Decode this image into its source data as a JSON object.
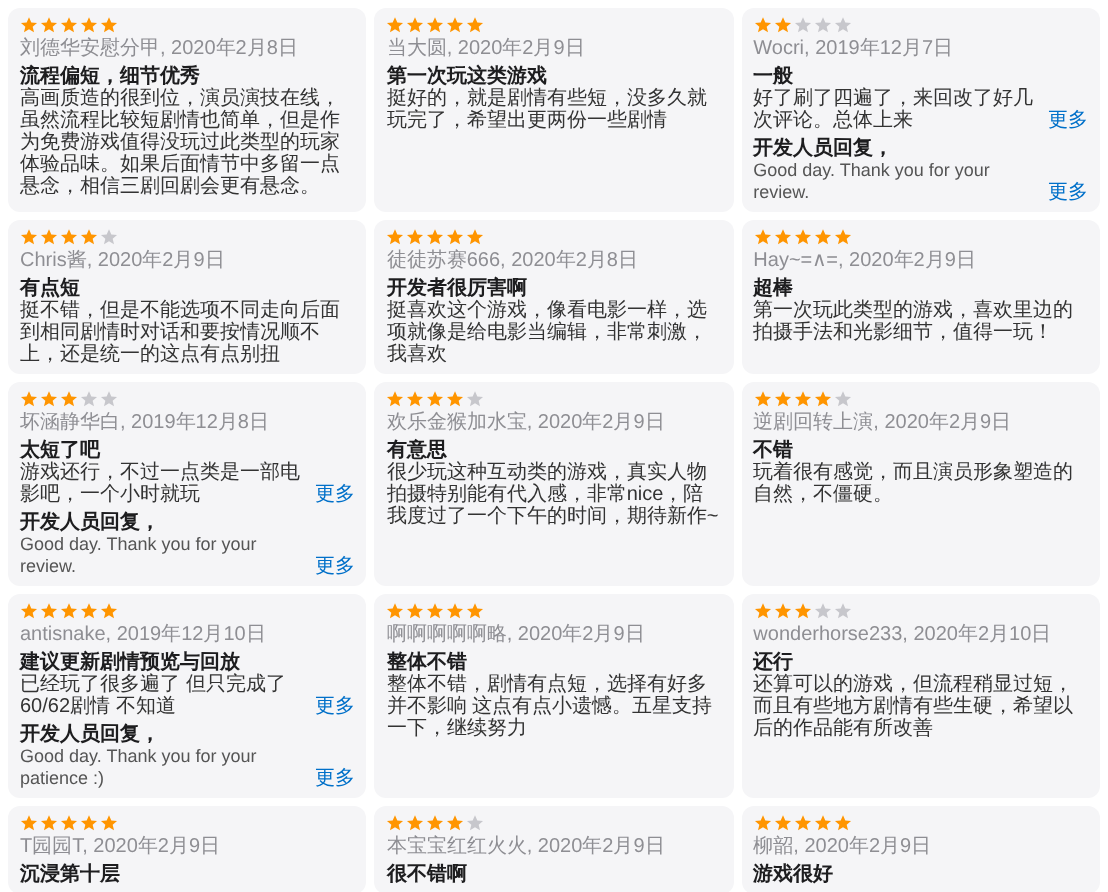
{
  "reviews": [
    {
      "stars": 5,
      "byline": "刘德华安慰分甲, 2020年2月8日",
      "title": "流程偏短，细节优秀",
      "body": "高画质造的很到位，演员演技在线，虽然流程比较短剧情也简单，但是作为免费游戏值得没玩过此类型的玩家体验品味。如果后面情节中多留一点悬念，相信三剧回剧会更有悬念。"
    },
    {
      "stars": 5,
      "byline": "当大圆, 2020年2月9日",
      "title": "第一次玩这类游戏",
      "body": "挺好的，就是剧情有些短，没多久就玩完了，希望出更两份一些剧情"
    },
    {
      "stars": 2,
      "byline": "Wocri, 2019年12月7日",
      "title": "一般",
      "body": "好了刷了四遍了，来回改了好几次评论。总体上来",
      "more": "更多",
      "reply": {
        "label": "开发人员回复，",
        "text": "Good day. Thank you for your review.",
        "more": "更多"
      }
    },
    {
      "stars": 4,
      "byline": "Chris酱, 2020年2月9日",
      "title": "有点短",
      "body": "挺不错，但是不能选项不同走向后面到相同剧情时对话和要按情况顺不上，还是统一的这点有点别扭"
    },
    {
      "stars": 5,
      "byline": "徒徒苏赛666, 2020年2月8日",
      "title": "开发者很厉害啊",
      "body": "挺喜欢这个游戏，像看电影一样，选项就像是给电影当编辑，非常刺激，我喜欢"
    },
    {
      "stars": 5,
      "byline": "Hay~=∧=, 2020年2月9日",
      "title": "超棒",
      "body": "第一次玩此类型的游戏，喜欢里边的拍摄手法和光影细节，值得一玩！"
    },
    {
      "stars": 3,
      "byline": "坏涵静华白, 2019年12月8日",
      "title": "太短了吧",
      "body": "游戏还行，不过一点类是一部电影吧，一个小时就玩",
      "more": "更多",
      "reply": {
        "label": "开发人员回复，",
        "text": "Good day. Thank you for your review.",
        "more": "更多"
      }
    },
    {
      "stars": 4,
      "byline": "欢乐金猴加水宝, 2020年2月9日",
      "title": "有意思",
      "body": "很少玩这种互动类的游戏，真实人物拍摄特别能有代入感，非常nice，陪我度过了一个下午的时间，期待新作~"
    },
    {
      "stars": 4,
      "byline": "逆剧回转上演, 2020年2月9日",
      "title": "不错",
      "body": "玩着很有感觉，而且演员形象塑造的自然，不僵硬。"
    },
    {
      "stars": 5,
      "byline": "antisnake, 2019年12月10日",
      "title": "建议更新剧情预览与回放",
      "body": "已经玩了很多遍了 但只完成了60/62剧情 不知道",
      "more": "更多",
      "reply": {
        "label": "开发人员回复，",
        "text": "Good day. Thank you for your patience :)",
        "more": "更多"
      }
    },
    {
      "stars": 5,
      "byline": "啊啊啊啊啊略, 2020年2月9日",
      "title": "整体不错",
      "body": "整体不错，剧情有点短，选择有好多并不影响 这点有点小遗憾。五星支持一下，继续努力"
    },
    {
      "stars": 3,
      "byline": "wonderhorse233, 2020年2月10日",
      "title": "还行",
      "body": "还算可以的游戏，但流程稍显过短，而且有些地方剧情有些生硬，希望以后的作品能有所改善"
    },
    {
      "stars": 5,
      "byline": "T园园T, 2020年2月9日",
      "title": "沉浸第十层"
    },
    {
      "stars": 4,
      "byline": "本宝宝红红火火, 2020年2月9日",
      "title": "很不错啊"
    },
    {
      "stars": 5,
      "byline": "柳韶, 2020年2月9日",
      "title": "游戏很好"
    }
  ]
}
